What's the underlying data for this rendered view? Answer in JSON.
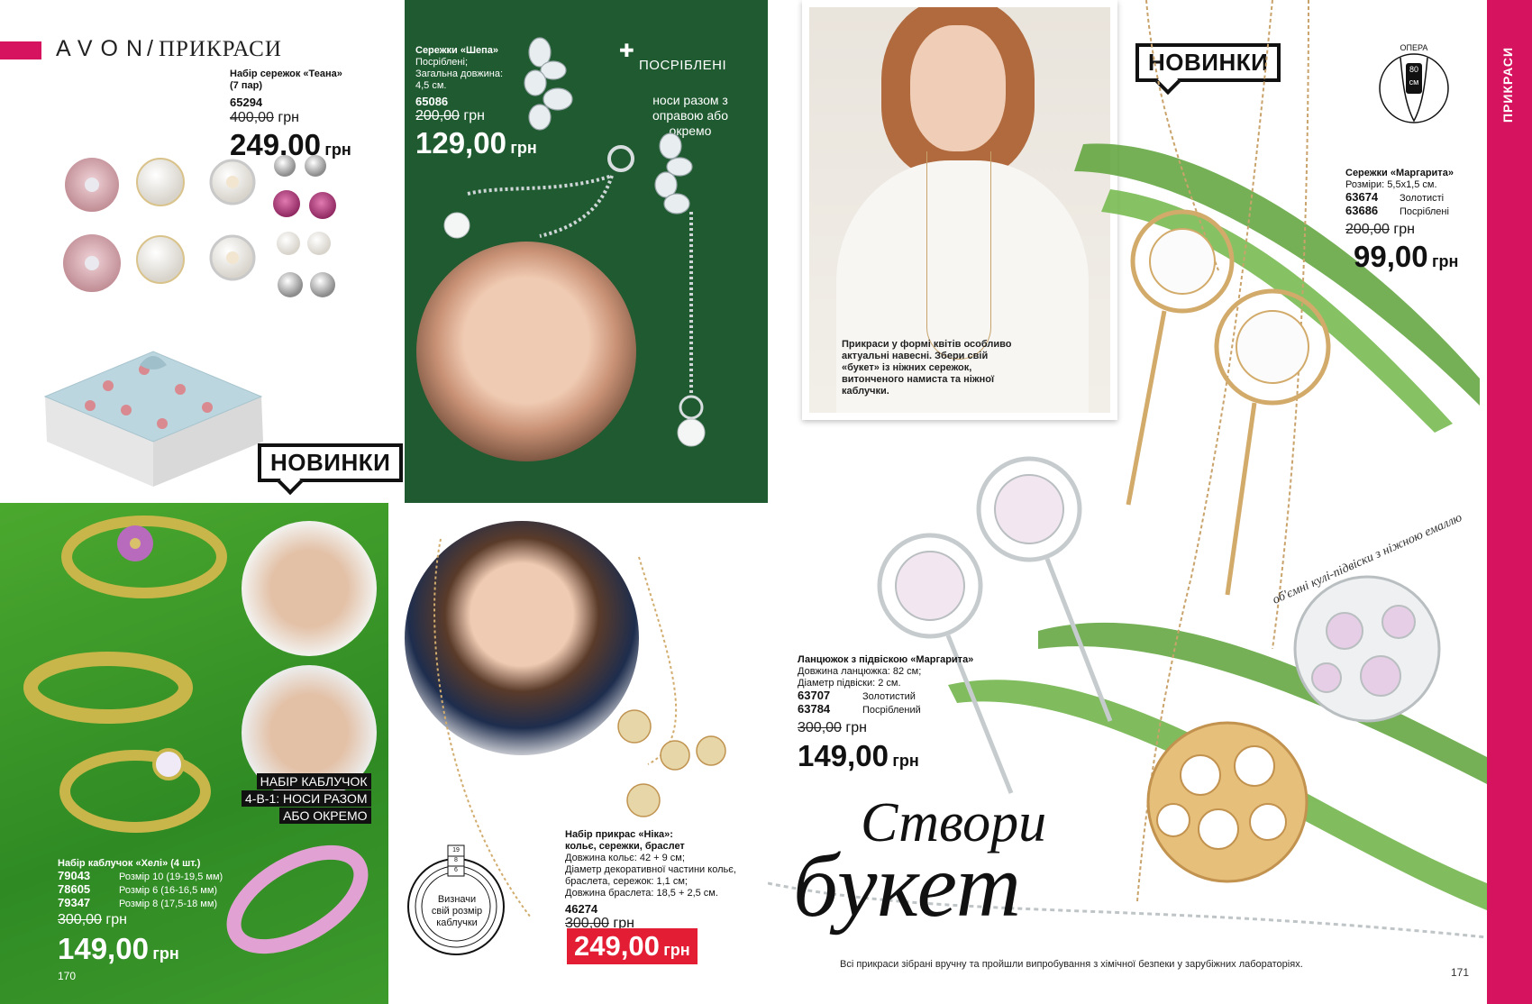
{
  "header": {
    "brand": "AVON",
    "section": "ПРИКРАСИ",
    "side_tab": "ПРИКРАСИ"
  },
  "colors": {
    "accent": "#d6135e",
    "green": "#1f5a30",
    "grass": "#3f9a2a"
  },
  "product_teana": {
    "name": "Набір сережок «Теана» (7 пар)",
    "code": "65294",
    "old_price": "400,00",
    "old_cur": "грн",
    "price": "249,00",
    "cur": "грн",
    "badge": "НОВИНКИ"
  },
  "product_shepa": {
    "name": "Сережки «Шепа»",
    "line1": "Посріблені;",
    "line2": "Загальна довжина:",
    "line3": "4,5 см.",
    "code": "65086",
    "old_price": "200,00",
    "old_cur": "грн",
    "price": "129,00",
    "cur": "грн",
    "label_silver": "ПОСРІБЛЕНІ",
    "note": "носи разом з оправою або окремо"
  },
  "lifestyle_caption": "Прикраси у формі квітів особливо актуальні навесні. Збери свій «букет» із ніжних сережок, витонченого намиста та ніжної каблучки.",
  "badge_new_right": "НОВИНКИ",
  "opera_icon": {
    "label": "ОПЕРА",
    "length": "80",
    "unit": "см"
  },
  "product_margarita_earrings": {
    "name": "Сережки «Маргарита»",
    "sizes": "Розміри: 5,5х1,5 см.",
    "code1": "63674",
    "variant1": "Золотисті",
    "code2": "63686",
    "variant2": "Посріблені",
    "old_price": "200,00",
    "old_cur": "грн",
    "price": "99,00",
    "cur": "грн"
  },
  "product_heli": {
    "name": "Набір каблучок «Хелі» (4 шт.)",
    "sizes": [
      {
        "code": "79043",
        "label": "Розмір 10 (19-19,5 мм)"
      },
      {
        "code": "78605",
        "label": "Розмір 6 (16-16,5 мм)"
      },
      {
        "code": "79347",
        "label": "Розмір 8 (17,5-18 мм)"
      }
    ],
    "old_price": "300,00",
    "old_cur": "грн",
    "price": "149,00",
    "cur": "грн",
    "callout_line1": "НАБІР КАБЛУЧОК",
    "callout_line2": "4-В-1: НОСИ РАЗОМ",
    "callout_line3": "АБО ОКРЕМО"
  },
  "ring_size_icon": {
    "text": "Визначи свій розмір каблучки",
    "marks": [
      "19",
      "8",
      "6"
    ]
  },
  "product_nika": {
    "name": "Набір прикрас «Ніка»:",
    "name2": "кольє, сережки, браслет",
    "line1": "Довжина кольє: 42 + 9 см;",
    "line2": "Діаметр декоративної частини кольє,",
    "line3": "браслета, сережок: 1,1 см;",
    "line4": "Довжина браслета: 18,5 + 2,5 см.",
    "code": "46274",
    "old_price": "300,00",
    "old_cur": "грн",
    "price": "249,00",
    "cur": "грн"
  },
  "product_margarita_necklace": {
    "name": "Ланцюжок з підвіскою «Маргарита»",
    "line1": "Довжина ланцюжка: 82 см;",
    "line2": "Діаметр підвіски: 2 см.",
    "code1": "63707",
    "variant1": "Золотистий",
    "code2": "63784",
    "variant2": "Посріблений",
    "old_price": "300,00",
    "old_cur": "грн",
    "price": "149,00",
    "cur": "грн"
  },
  "pendant_note": "об'ємні кулі-підвіски з ніжною емаллю",
  "headline": {
    "line1": "Створи",
    "line2": "букет"
  },
  "footer_note": "Всі прикраси зібрані вручну та пройшли випробування з хімічної безпеки у зарубіжних лабораторіях.",
  "page_left": "170",
  "page_right": "171"
}
